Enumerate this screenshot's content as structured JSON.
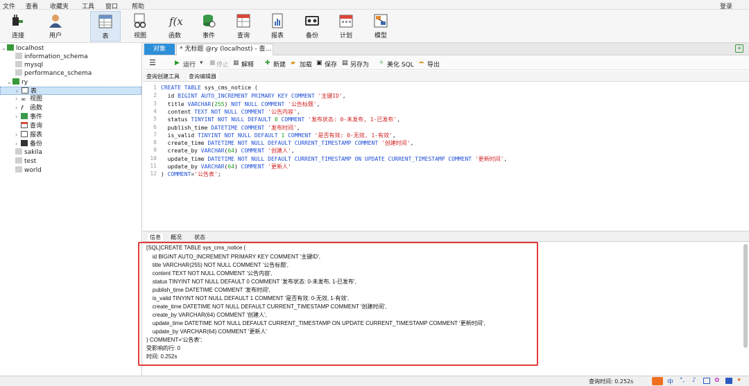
{
  "menu": {
    "file": "文件",
    "view": "查看",
    "fav": "收藏夹",
    "tools": "工具",
    "window": "窗口",
    "help": "帮助",
    "login": "登录"
  },
  "toolbar": {
    "connect": "连接",
    "user": "用户",
    "table": "表",
    "view": "视图",
    "function": "函数",
    "event": "事件",
    "query": "查询",
    "report": "报表",
    "backup": "备份",
    "schedule": "计划",
    "model": "模型"
  },
  "tree": {
    "localhost": "localhost",
    "information_schema": "information_schema",
    "mysql": "mysql",
    "performance_schema": "performance_schema",
    "ry": "ry",
    "tables": "表",
    "views": "视图",
    "functions": "函数",
    "events": "事件",
    "queries": "查询",
    "reports": "报表",
    "backups": "备份",
    "sakila": "sakila",
    "test": "test",
    "world": "world"
  },
  "tabs": {
    "objects": "对象",
    "query_tab": "* 无标题 @ry (localhost) - 查..."
  },
  "qbar": {
    "run": "运行",
    "stop": "停止",
    "explain": "解释",
    "new": "新建",
    "load": "加载",
    "save": "保存",
    "saveas": "另存为",
    "beautify": "美化 SQL",
    "export": "导出"
  },
  "subtabs": {
    "builder": "查询创建工具",
    "editor": "查询编辑器"
  },
  "editor": {
    "lines": [
      "1",
      "2",
      "3",
      "4",
      "5",
      "6",
      "7",
      "8",
      "9",
      "10",
      "11",
      "12"
    ],
    "code": [
      [
        "CREATE TABLE sys_cms_notice ("
      ],
      [
        "  id BIGINT AUTO_INCREMENT PRIMARY KEY COMMENT '主键ID',"
      ],
      [
        "  title VARCHAR(255) NOT NULL COMMENT '公告标题',"
      ],
      [
        "  content TEXT NOT NULL COMMENT '公告内容',"
      ],
      [
        "  status TINYINT NOT NULL DEFAULT 0 COMMENT '发布状态: 0-未发布, 1-已发布',"
      ],
      [
        "  publish_time DATETIME COMMENT '发布时间',"
      ],
      [
        "  is_valid TINYINT NOT NULL DEFAULT 1 COMMENT '是否有效: 0-无效, 1-有效',"
      ],
      [
        "  create_time DATETIME NOT NULL DEFAULT CURRENT_TIMESTAMP COMMENT '创建时间',"
      ],
      [
        "  create_by VARCHAR(64) COMMENT '创建人',"
      ],
      [
        "  update_time DATETIME NOT NULL DEFAULT CURRENT_TIMESTAMP ON UPDATE CURRENT_TIMESTAMP COMMENT '更新时间',"
      ],
      [
        "  update_by VARCHAR(64) COMMENT '更新人'"
      ],
      [
        ") COMMENT='公告表';"
      ]
    ]
  },
  "btabs": {
    "info": "信息",
    "overview": "概况",
    "status": "状态"
  },
  "info": {
    "lines": [
      "[SQL]CREATE TABLE sys_cms_notice (",
      "    id BIGINT AUTO_INCREMENT PRIMARY KEY COMMENT '主键ID',",
      "    title VARCHAR(255) NOT NULL COMMENT '公告标题',",
      "    content TEXT NOT NULL COMMENT '公告内容',",
      "    status TINYINT NOT NULL DEFAULT 0 COMMENT '发布状态: 0-未发布, 1-已发布',",
      "    publish_time DATETIME COMMENT '发布时间',",
      "    is_valid TINYINT NOT NULL DEFAULT 1 COMMENT '是否有效: 0-无效, 1-有效',",
      "    create_time DATETIME NOT NULL DEFAULT CURRENT_TIMESTAMP COMMENT '创建时间',",
      "    create_by VARCHAR(64) COMMENT '创建人',",
      "    update_time DATETIME NOT NULL DEFAULT CURRENT_TIMESTAMP ON UPDATE CURRENT_TIMESTAMP COMMENT '更新时间',",
      "    update_by VARCHAR(64) COMMENT '更新人'",
      ") COMMENT='公告表';",
      "受影响的行: 0",
      "时间: 0.252s"
    ]
  },
  "status": {
    "query_time": "查询时间: 0.252s",
    "ime": "中"
  }
}
